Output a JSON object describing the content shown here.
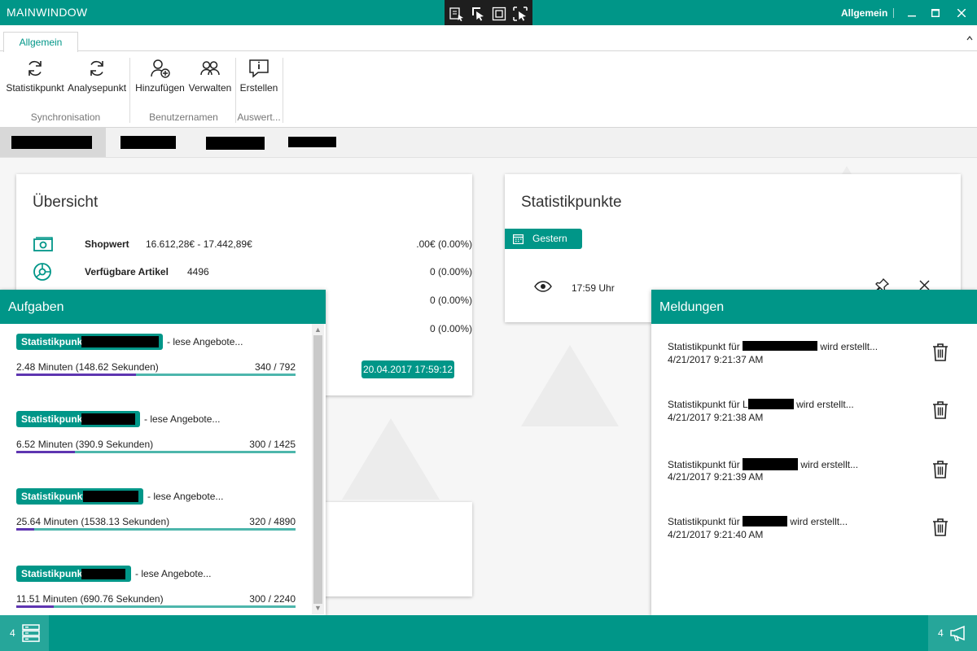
{
  "window": {
    "title": "MAINWINDOW",
    "user": "Allgemein",
    "controls": [
      "minimize",
      "maximize",
      "close"
    ]
  },
  "ribbon": {
    "tab": "Allgemein",
    "groups": [
      {
        "label": "Synchronisation",
        "buttons": [
          {
            "label": "Statistikpunkt",
            "icon": "sync-icon"
          },
          {
            "label": "Analysepunkt",
            "icon": "sync-icon"
          }
        ]
      },
      {
        "label": "Benutzernamen",
        "buttons": [
          {
            "label": "Hinzufügen",
            "icon": "add-user-icon"
          },
          {
            "label": "Verwalten",
            "icon": "users-icon"
          }
        ]
      },
      {
        "label": "Auswert...",
        "buttons": [
          {
            "label": "Erstellen",
            "icon": "comment-icon"
          }
        ]
      }
    ]
  },
  "overview": {
    "title": "Übersicht",
    "rows": [
      {
        "label": "Shopwert",
        "value": "16.612,28€ - 17.442,89€",
        "delta": ".00€ (0.00%)",
        "icon": "money-icon"
      },
      {
        "label": "Verfügbare Artikel",
        "value": "4496",
        "delta": "0 (0.00%)",
        "icon": "pie-chart-icon"
      },
      {
        "label": "",
        "value": "",
        "delta": "0 (0.00%)"
      },
      {
        "label": "",
        "value": "",
        "delta": "0 (0.00%)"
      }
    ],
    "timestamp": "20.04.2017 17:59:12"
  },
  "statistikpunkte": {
    "title": "Statistikpunkte",
    "filter": "Gestern",
    "entry_time": "17:59 Uhr"
  },
  "aufgaben": {
    "title": "Aufgaben",
    "tasks": [
      {
        "chip": "Statistikpunkt",
        "action": "- lese Angebote...",
        "time": "2.48 Minuten (148.62 Sekunden)",
        "count": "340 / 792",
        "progress": 0.429
      },
      {
        "chip": "Statistikpunkt",
        "action": "- lese Angebote...",
        "time": "6.52 Minuten (390.9 Sekunden)",
        "count": "300 / 1425",
        "progress": 0.211
      },
      {
        "chip": "Statistikpunkt",
        "action": "- lese Angebote...",
        "time": "25.64 Minuten (1538.13 Sekunden)",
        "count": "320 / 4890",
        "progress": 0.065
      },
      {
        "chip": "Statistikpunkt",
        "action": "- lese Angebote...",
        "time": "11.51 Minuten (690.76 Sekunden)",
        "count": "300 / 2240",
        "progress": 0.134
      }
    ]
  },
  "meldungen": {
    "title": "Meldungen",
    "messages": [
      {
        "prefix": "Statistikpunkt für",
        "suffix": "wird erstellt...",
        "date": "4/21/2017 9:21:37 AM"
      },
      {
        "prefix": "Statistikpunkt für L",
        "suffix": "wird erstellt...",
        "date": "4/21/2017 9:21:38 AM"
      },
      {
        "prefix": "Statistikpunkt für",
        "suffix": "wird erstellt...",
        "date": "4/21/2017 9:21:39 AM"
      },
      {
        "prefix": "Statistikpunkt für",
        "suffix": "wird erstellt...",
        "date": "4/21/2017 9:21:40 AM"
      }
    ]
  },
  "statusbar": {
    "tasks_count": "4",
    "messages_count": "4"
  },
  "colors": {
    "accent": "#009688",
    "accent_light": "#4db6ac",
    "progress_fill": "#5e35b1"
  }
}
